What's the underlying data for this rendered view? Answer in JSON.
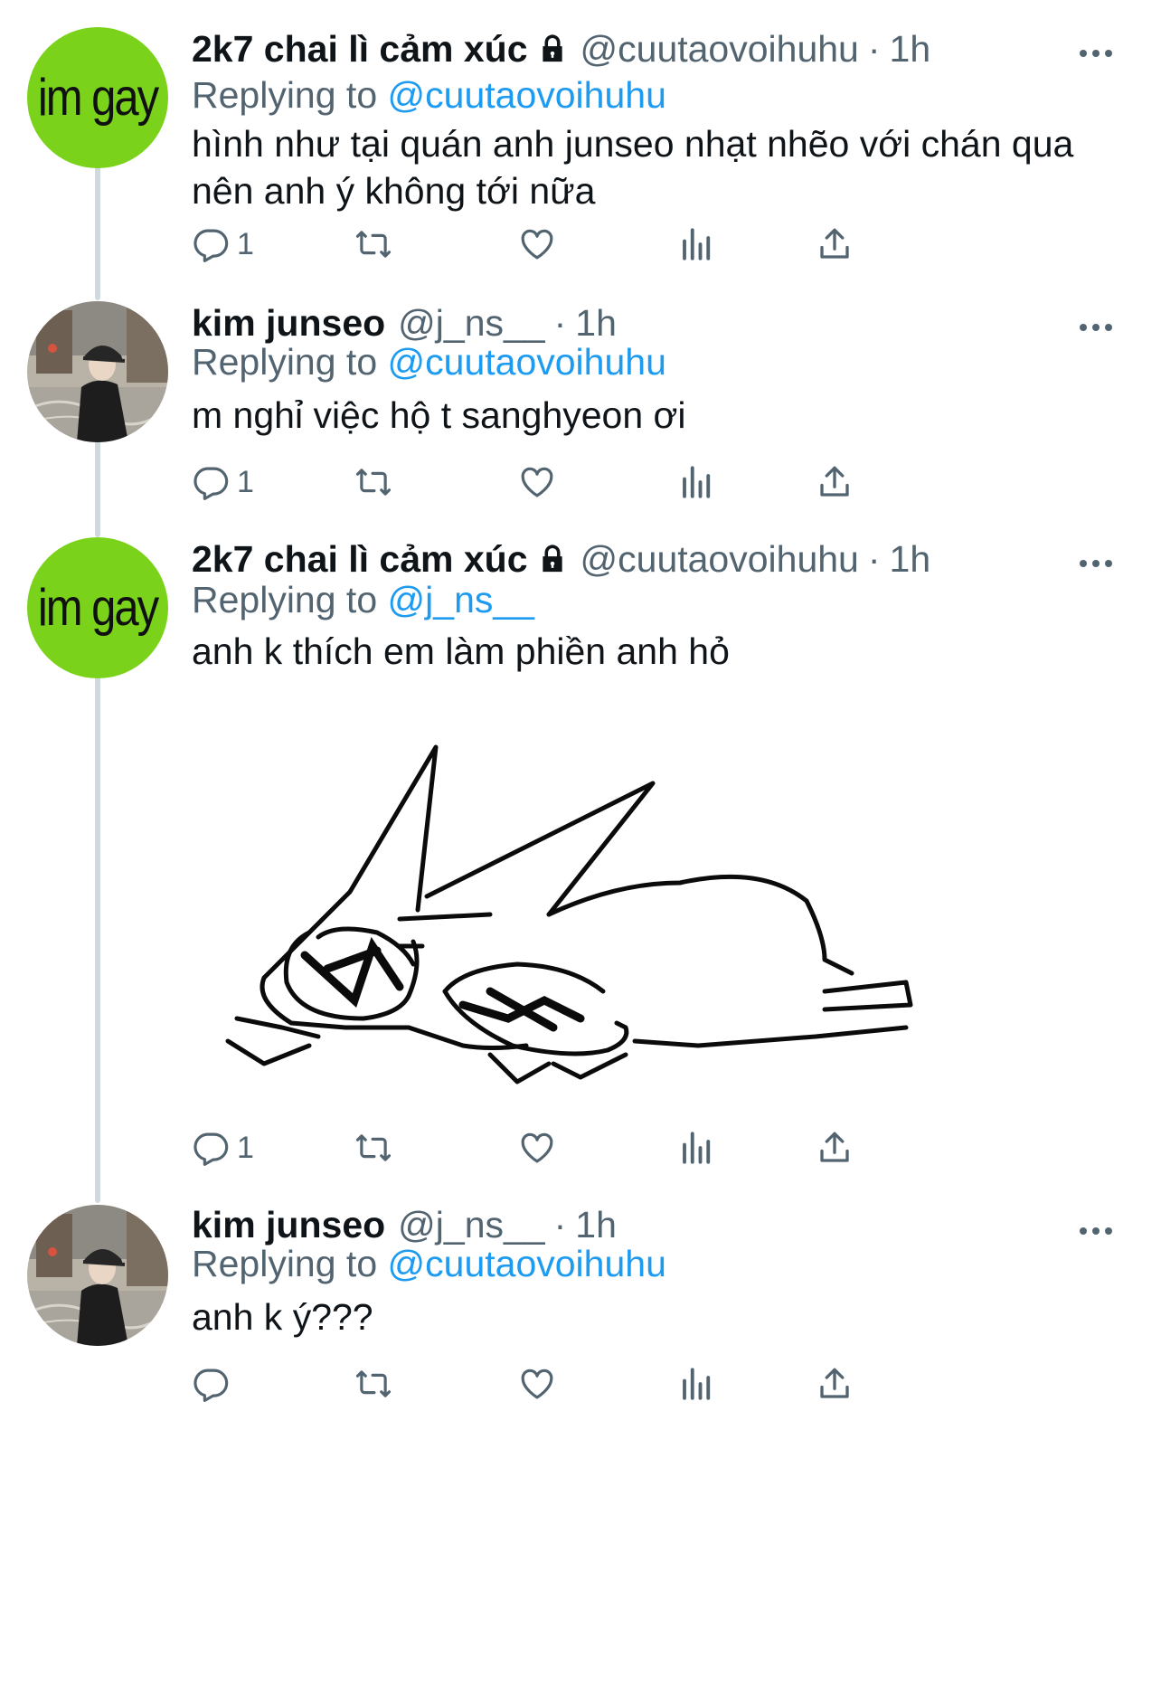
{
  "tweets": [
    {
      "name": "2k7 chai lì cảm xúc",
      "handle": "@cuutaovoihuhu",
      "time": "1h",
      "replying_label": "Replying to",
      "replying_to": "@cuutaovoihuhu",
      "text": "hình như tại quán anh junseo nhạt nhẽo với chán qua nên anh ý không tới nữa",
      "replies": "1",
      "avatar_text": "im gay",
      "locked": true
    },
    {
      "name": "kim junseo",
      "handle": "@j_ns__",
      "time": "1h",
      "replying_label": "Replying to",
      "replying_to": "@cuutaovoihuhu",
      "text": "m nghỉ việc hộ t sanghyeon ơi",
      "replies": "1",
      "locked": false
    },
    {
      "name": "2k7 chai lì cảm xúc",
      "handle": "@cuutaovoihuhu",
      "time": "1h",
      "replying_label": "Replying to",
      "replying_to": "@j_ns__",
      "text": "anh k thích em làm phiền anh hỏ",
      "replies": "1",
      "avatar_text": "im gay",
      "locked": true,
      "media": "sketch of a sleepy cartoon creature lying down"
    },
    {
      "name": "kim junseo",
      "handle": "@j_ns__",
      "time": "1h",
      "replying_label": "Replying to",
      "replying_to": "@cuutaovoihuhu",
      "text": "anh k ý???",
      "replies": "",
      "locked": false
    }
  ],
  "dot_separator": "·",
  "colors": {
    "link": "#1d9bf0",
    "muted": "#536471",
    "avatar_green": "#7ad31a",
    "thread_line": "#cfd9de"
  },
  "icons": [
    "reply-icon",
    "retweet-icon",
    "like-icon",
    "views-icon",
    "share-icon",
    "more-icon",
    "lock-icon"
  ]
}
